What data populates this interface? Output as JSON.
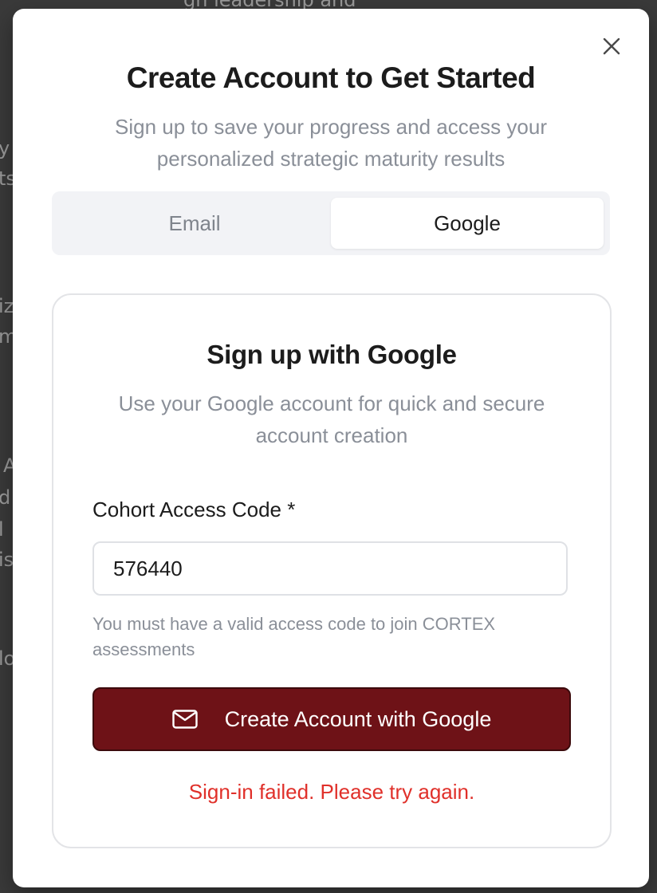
{
  "backdrop": {
    "fragments": [
      "gh leadership and",
      "y",
      "ts",
      "iz",
      "m",
      "A",
      "d",
      "l",
      "is",
      "lo"
    ]
  },
  "modal": {
    "close_icon": "close-icon",
    "title": "Create Account to Get Started",
    "subtitle": "Sign up to save your progress and access your personalized strategic maturity results",
    "tabs": [
      {
        "label": "Email",
        "active": false
      },
      {
        "label": "Google",
        "active": true
      }
    ]
  },
  "card": {
    "title": "Sign up with Google",
    "description": "Use your Google account for quick and secure account creation",
    "access_code": {
      "label": "Cohort Access Code *",
      "value": "576440",
      "help": "You must have a valid access code to join CORTEX assessments"
    },
    "submit": {
      "icon": "mail-icon",
      "label": "Create Account with Google"
    },
    "error": "Sign-in failed. Please try again."
  },
  "colors": {
    "accent": "#6e1217",
    "error": "#e0302a",
    "muted_text": "#8a8f98"
  }
}
